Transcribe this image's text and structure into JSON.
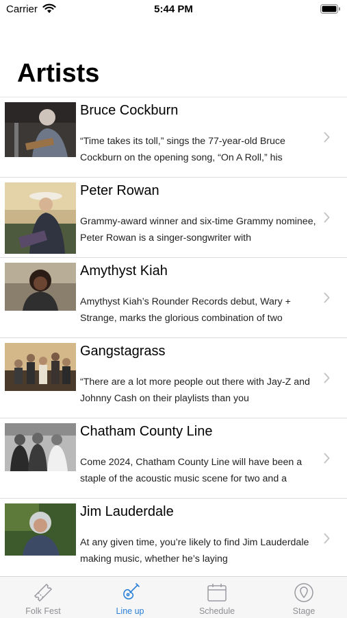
{
  "status_bar": {
    "carrier": "Carrier",
    "time": "5:44 PM"
  },
  "page_title": "Artists",
  "artists": [
    {
      "name": "Bruce Cockburn",
      "description": "“Time takes its toll,” sings the 77-year-old Bruce Cockburn on the opening song, “On A Roll,” his"
    },
    {
      "name": "Peter Rowan",
      "description": "Grammy-award winner and six-time Grammy nominee, Peter Rowan is a singer-songwriter with"
    },
    {
      "name": "Amythyst Kiah",
      "description": "Amythyst Kiah’s Rounder Records debut, Wary + Strange, marks the glorious combination of two"
    },
    {
      "name": "Gangstagrass",
      "description": "“There are a lot more people out there with Jay-Z and Johnny Cash on their playlists than you"
    },
    {
      "name": "Chatham County Line",
      "description": "Come 2024, Chatham County Line will have been a staple of the acoustic music scene for two and a"
    },
    {
      "name": "Jim Lauderdale",
      "description": "At any given time, you’re likely to find Jim Lauderdale making music, whether he’s laying"
    }
  ],
  "tabs": [
    {
      "label": "Folk Fest",
      "icon": "ticket-icon",
      "active": false
    },
    {
      "label": "Line up",
      "icon": "guitar-icon",
      "active": true
    },
    {
      "label": "Schedule",
      "icon": "calendar-icon",
      "active": false
    },
    {
      "label": "Stage",
      "icon": "map-pin-icon",
      "active": false
    }
  ],
  "colors": {
    "accent": "#2a80d8",
    "inactive": "#8e8e93",
    "separator": "#dcdcdc"
  }
}
